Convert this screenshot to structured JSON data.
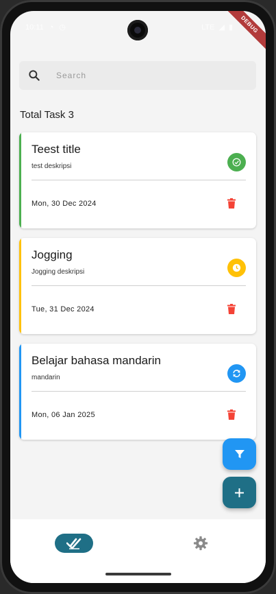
{
  "colors": {
    "accent_green": "#4caf50",
    "accent_yellow": "#ffc107",
    "accent_blue": "#2196f3",
    "delete_red": "#f44336",
    "fab_filter": "#2196f3",
    "fab_add": "#1f6f86",
    "nav_active": "#1f6f86"
  },
  "status_bar": {
    "time": "10:11",
    "network": "LTE",
    "ribbon": "DEBUG"
  },
  "search": {
    "placeholder": "Search"
  },
  "summary": {
    "label": "Total Task 3"
  },
  "tasks": [
    {
      "title": "Teest title",
      "description": "test deskripsi",
      "date": "Mon, 30 Dec 2024",
      "status_icon": "check-circle-icon"
    },
    {
      "title": "Jogging",
      "description": "Jogging deskripsi",
      "date": "Tue, 31 Dec 2024",
      "status_icon": "clock-icon"
    },
    {
      "title": "Belajar bahasa mandarin",
      "description": "mandarin",
      "date": "Mon, 06 Jan 2025",
      "status_icon": "sync-icon"
    }
  ],
  "fabs": {
    "filter_icon": "filter-icon",
    "add_icon": "plus-icon"
  },
  "bottom_nav": {
    "items": [
      {
        "icon": "double-check-icon",
        "active": true
      },
      {
        "icon": "gear-icon",
        "active": false
      }
    ]
  }
}
